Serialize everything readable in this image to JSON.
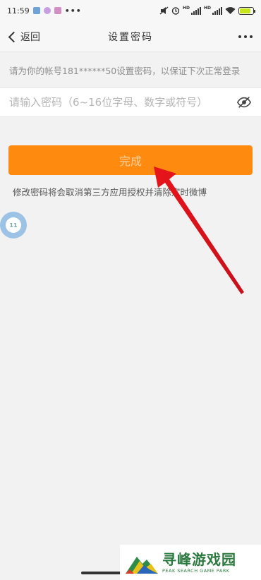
{
  "status_bar": {
    "time": "11:59",
    "more": "•••",
    "icons": [
      "shield-icon",
      "hexagon-icon",
      "shield-badge-icon",
      "mute-icon",
      "alarm-icon",
      "signal-hd-icon",
      "signal-hd-icon",
      "wifi-icon",
      "battery-icon"
    ],
    "hd_label": "HD"
  },
  "nav": {
    "back_label": "返回",
    "title": "设置密码"
  },
  "hint_text": "请为你的帐号181******50设置密码，以保证下次正常登录",
  "password": {
    "value": "",
    "placeholder": "请输入密码（6~16位字母、数字或符号）"
  },
  "done_button_label": "完成",
  "notice_text": "修改密码将会取消第三方应用授权并清除定时微博",
  "float_ball_label": "11",
  "watermark": {
    "title": "寻峰游戏园",
    "subtitle": "PEAK SEARCH GAME PARK"
  },
  "colors": {
    "accent": "#ff8a10",
    "arrow": "#e8141b",
    "background": "#f2f2f2"
  }
}
